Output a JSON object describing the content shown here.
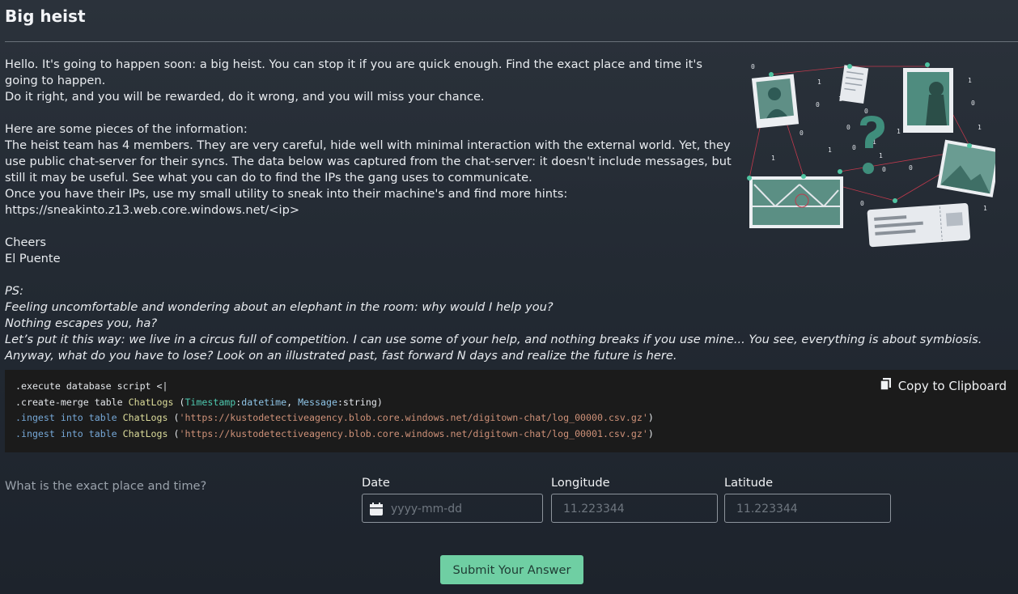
{
  "page": {
    "title": "Big heist"
  },
  "story": {
    "paragraph1_line1": "Hello. It's going to happen soon: a big heist. You can stop it if you are quick enough. Find the exact place and time it's going to happen.",
    "paragraph1_line2": "Do it right, and you will be rewarded, do it wrong, and you will miss your chance.",
    "paragraph2_intro": "Here are some pieces of the information:",
    "paragraph2_body": "The heist team has 4 members. They are very careful, hide well with minimal interaction with the external world. Yet, they use public chat-server for their syncs. The data below was captured from the chat-server: it doesn't include messages, but still it may be useful. See what you can do to find the IPs the gang uses to communicate.",
    "paragraph2_utility": "Once you have their IPs, use my small utility to sneak into their machine's and find more hints:",
    "url": "https://sneakinto.z13.web.core.windows.net/<ip>",
    "signoff": "Cheers",
    "signature": "El Puente"
  },
  "ps": {
    "label": "PS:",
    "line1": "Feeling uncomfortable and wondering about an elephant in the room: why would I help you?",
    "line2": "Nothing escapes you, ha?",
    "line3": "Let’s put it this way: we live in a circus full of competition. I can use some of your help, and nothing breaks if you use mine... You see, everything is about symbiosis.",
    "line4": "Anyway, what do you have to lose? Look on an illustrated past, fast forward N days and realize the future is here."
  },
  "code": {
    "copy_label": "Copy to Clipboard",
    "copy_icon": "copy-icon",
    "line1": {
      "cmd": ".execute",
      "rest": " database script <|"
    },
    "line2": {
      "cmd": ".create-merge",
      "kw": "table",
      "table": "ChatLogs",
      "col1": "Timestamp",
      "type1": "datetime",
      "col2": "Message",
      "type2": "string"
    },
    "line3": {
      "cmd": ".ingest",
      "kw": "into table",
      "table": "ChatLogs",
      "url": "'https://kustodetectiveagency.blob.core.windows.net/digitown-chat/log_00000.csv.gz'"
    },
    "line4": {
      "cmd": ".ingest",
      "kw": "into table",
      "table": "ChatLogs",
      "url": "'https://kustodetectiveagency.blob.core.windows.net/digitown-chat/log_00001.csv.gz'"
    }
  },
  "answer": {
    "question": "What is the exact place and time?",
    "date_label": "Date",
    "date_placeholder": "yyyy-mm-dd",
    "date_icon": "calendar-icon",
    "longitude_label": "Longitude",
    "longitude_placeholder": "11.223344",
    "latitude_label": "Latitude",
    "latitude_placeholder": "11.223344",
    "submit_label": "Submit Your Answer"
  },
  "colors": {
    "accent": "#6fcfa3",
    "background": "#262d36",
    "code_bg": "#1b1b1b"
  }
}
